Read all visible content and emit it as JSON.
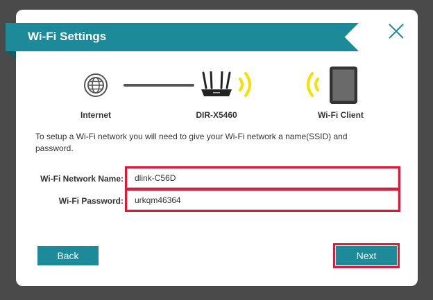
{
  "dialog": {
    "title": "Wi-Fi Settings",
    "close_icon": "close-x-icon"
  },
  "diagram": {
    "internet_label": "Internet",
    "router_label": "DIR-X5460",
    "client_label": "Wi-Fi Client",
    "icons": {
      "internet": "globe-icon",
      "router": "router-icon",
      "signal": "wifi-signal-icon",
      "client": "tablet-icon"
    }
  },
  "instructions": "To setup a Wi-Fi network you will need to give your Wi-Fi network a name(SSID) and password.",
  "form": {
    "network_name_label": "Wi-Fi Network Name:",
    "network_name_value": "dlink-C56D",
    "password_label": "Wi-Fi Password:",
    "password_value": "urkqm46364"
  },
  "buttons": {
    "back_label": "Back",
    "next_label": "Next"
  },
  "colors": {
    "accent": "#1d8a99",
    "highlight": "#e0183a",
    "signal": "#f5e000",
    "backdrop": "#4a4a4a"
  }
}
